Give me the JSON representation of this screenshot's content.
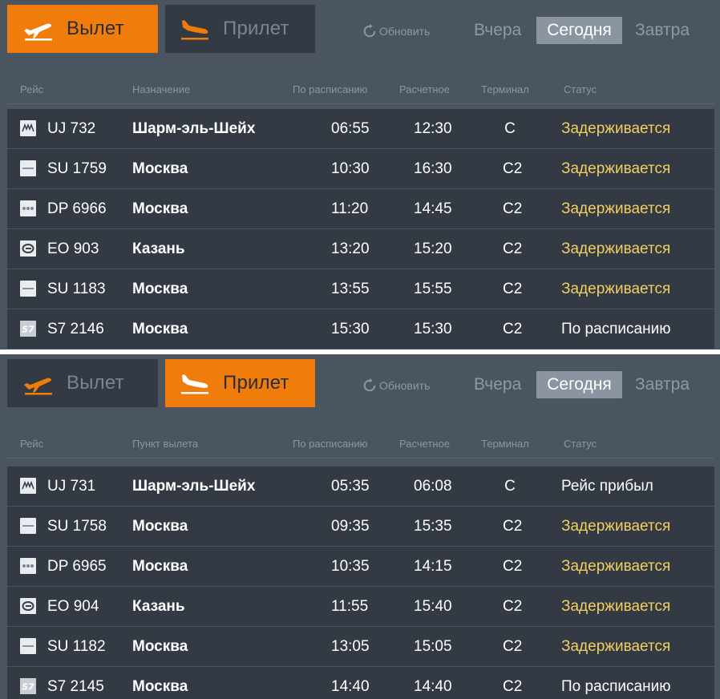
{
  "departures": {
    "tabs": {
      "departure": "Вылет",
      "arrival": "Прилет"
    },
    "refresh": "Обновить",
    "days": {
      "yesterday": "Вчера",
      "today": "Сегодня",
      "tomorrow": "Завтра"
    },
    "columns": {
      "flight": "Рейс",
      "place": "Назначение",
      "scheduled": "По расписанию",
      "estimated": "Расчетное",
      "terminal": "Терминал",
      "status": "Статус"
    },
    "rows": [
      {
        "logo": "uj-logo",
        "flight": "UJ 732",
        "place": "Шарм-эль-Шейх",
        "scheduled": "06:55",
        "estimated": "12:30",
        "terminal": "C",
        "status": "Задерживается",
        "status_type": "delayed"
      },
      {
        "logo": "su-logo",
        "flight": "SU 1759",
        "place": "Москва",
        "scheduled": "10:30",
        "estimated": "16:30",
        "terminal": "C2",
        "status": "Задерживается",
        "status_type": "delayed"
      },
      {
        "logo": "dp-logo",
        "flight": "DP 6966",
        "place": "Москва",
        "scheduled": "11:20",
        "estimated": "14:45",
        "terminal": "C2",
        "status": "Задерживается",
        "status_type": "delayed"
      },
      {
        "logo": "eo-logo",
        "flight": "EO 903",
        "place": "Казань",
        "scheduled": "13:20",
        "estimated": "15:20",
        "terminal": "C2",
        "status": "Задерживается",
        "status_type": "delayed"
      },
      {
        "logo": "su-logo",
        "flight": "SU 1183",
        "place": "Москва",
        "scheduled": "13:55",
        "estimated": "15:55",
        "terminal": "C2",
        "status": "Задерживается",
        "status_type": "delayed"
      },
      {
        "logo": "s7-logo",
        "flight": "S7 2146",
        "place": "Москва",
        "scheduled": "15:30",
        "estimated": "15:30",
        "terminal": "C2",
        "status": "По расписанию",
        "status_type": "normal"
      }
    ]
  },
  "arrivals": {
    "tabs": {
      "departure": "Вылет",
      "arrival": "Прилет"
    },
    "refresh": "Обновить",
    "days": {
      "yesterday": "Вчера",
      "today": "Сегодня",
      "tomorrow": "Завтра"
    },
    "columns": {
      "flight": "Рейс",
      "place": "Пункт вылета",
      "scheduled": "По расписанию",
      "estimated": "Расчетное",
      "terminal": "Терминал",
      "status": "Статус"
    },
    "rows": [
      {
        "logo": "uj-logo",
        "flight": "UJ 731",
        "place": "Шарм-эль-Шейх",
        "scheduled": "05:35",
        "estimated": "06:08",
        "terminal": "C",
        "status": "Рейс прибыл",
        "status_type": "normal"
      },
      {
        "logo": "su-logo",
        "flight": "SU 1758",
        "place": "Москва",
        "scheduled": "09:35",
        "estimated": "15:35",
        "terminal": "C2",
        "status": "Задерживается",
        "status_type": "delayed"
      },
      {
        "logo": "dp-logo",
        "flight": "DP 6965",
        "place": "Москва",
        "scheduled": "10:35",
        "estimated": "14:15",
        "terminal": "C2",
        "status": "Задерживается",
        "status_type": "delayed"
      },
      {
        "logo": "eo-logo",
        "flight": "EO 904",
        "place": "Казань",
        "scheduled": "11:55",
        "estimated": "15:40",
        "terminal": "C2",
        "status": "Задерживается",
        "status_type": "delayed"
      },
      {
        "logo": "su-logo",
        "flight": "SU 1182",
        "place": "Москва",
        "scheduled": "13:05",
        "estimated": "15:05",
        "terminal": "C2",
        "status": "Задерживается",
        "status_type": "delayed"
      },
      {
        "logo": "s7-logo",
        "flight": "S7 2145",
        "place": "Москва",
        "scheduled": "14:40",
        "estimated": "14:40",
        "terminal": "C2",
        "status": "По расписанию",
        "status_type": "normal"
      }
    ]
  },
  "colors": {
    "accent": "#f07c0c",
    "panel": "#4b5560",
    "row": "#333a43",
    "delayed": "#f2cf62"
  }
}
